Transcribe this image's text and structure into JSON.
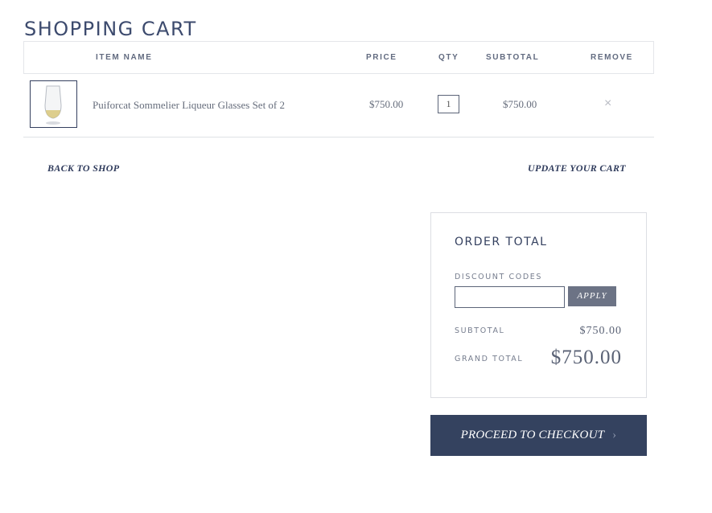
{
  "page": {
    "title": "SHOPPING CART"
  },
  "table": {
    "headers": {
      "item_name": "ITEM NAME",
      "price": "PRICE",
      "qty": "QTY",
      "subtotal": "SUBTOTAL",
      "remove": "REMOVE"
    },
    "rows": [
      {
        "name": "Puiforcat Sommelier Liqueur Glasses Set of 2",
        "price": "$750.00",
        "qty": "1",
        "subtotal": "$750.00",
        "remove": "×"
      }
    ]
  },
  "actions": {
    "back_to_shop": "BACK TO SHOP",
    "update_cart": "UPDATE YOUR CART"
  },
  "order_total": {
    "title": "ORDER TOTAL",
    "discount_label": "DISCOUNT CODES",
    "discount_value": "",
    "apply_label": "APPLY",
    "subtotal_label": "SUBTOTAL",
    "subtotal_value": "$750.00",
    "grand_total_label": "GRAND TOTAL",
    "grand_total_value": "$750.00"
  },
  "checkout": {
    "label": "PROCEED TO CHECKOUT",
    "chevron": "›"
  },
  "colors": {
    "brand_navy": "#34425f",
    "apply_gray": "#6c7385"
  }
}
